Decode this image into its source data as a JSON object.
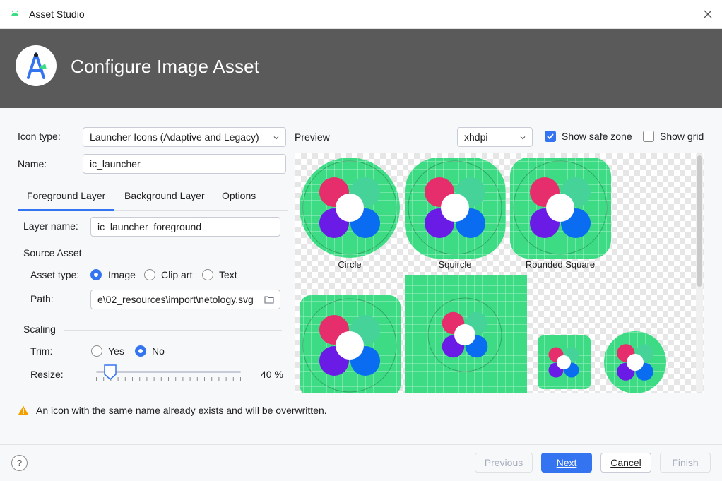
{
  "window": {
    "title": "Asset Studio"
  },
  "banner": {
    "heading": "Configure Image Asset"
  },
  "form": {
    "icon_type_label": "Icon type:",
    "icon_type_value": "Launcher Icons (Adaptive and Legacy)",
    "name_label": "Name:",
    "name_value": "ic_launcher"
  },
  "tabs": [
    {
      "label": "Foreground Layer",
      "active": true
    },
    {
      "label": "Background Layer",
      "active": false
    },
    {
      "label": "Options",
      "active": false
    }
  ],
  "foreground": {
    "layer_name_label": "Layer name:",
    "layer_name_value": "ic_launcher_foreground",
    "source_asset_title": "Source Asset",
    "asset_type_label": "Asset type:",
    "asset_type_options": [
      "Image",
      "Clip art",
      "Text"
    ],
    "asset_type_selected": "Image",
    "path_label": "Path:",
    "path_value": "e\\02_resources\\import\\netology.svg",
    "scaling_title": "Scaling",
    "trim_label": "Trim:",
    "trim_options": [
      "Yes",
      "No"
    ],
    "trim_selected": "No",
    "resize_label": "Resize:",
    "resize_value": "40 %",
    "resize_percent": 40
  },
  "preview": {
    "label": "Preview",
    "density": "xhdpi",
    "show_safe_zone_label": "Show safe zone",
    "show_safe_zone": true,
    "show_grid_label": "Show grid",
    "show_grid": false,
    "captions": [
      "Circle",
      "Squircle",
      "Rounded Square"
    ]
  },
  "warning": {
    "text": "An icon with the same name already exists and will be overwritten.",
    "color": "#f2a000"
  },
  "buttons": {
    "help": "?",
    "previous": "Previous",
    "next": "Next",
    "cancel": "Cancel",
    "finish": "Finish"
  },
  "colors": {
    "accent": "#3574f0",
    "icon_background": "#3ddc84",
    "dot_pink": "#e72e6c",
    "dot_teal": "#46d39a",
    "dot_purple": "#6a1ce6",
    "dot_blue": "#0a6cf0"
  }
}
